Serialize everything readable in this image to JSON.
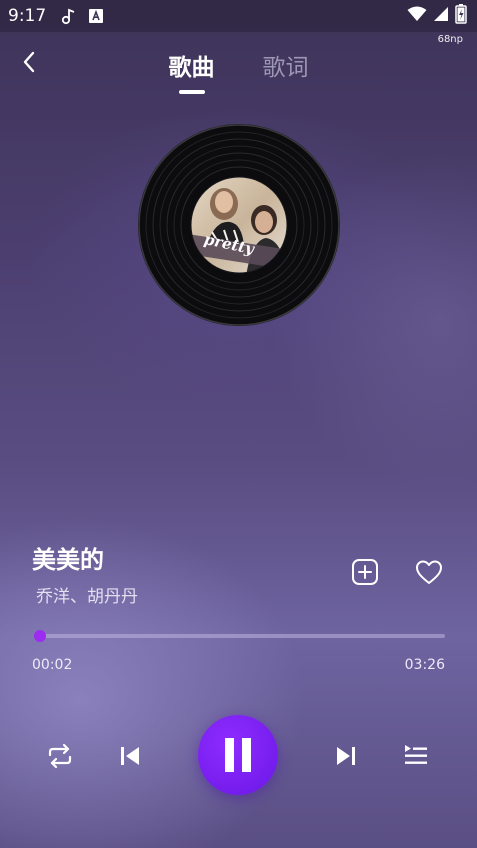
{
  "status_bar": {
    "time": "9:17",
    "icons": [
      "music-note-icon",
      "a-box-icon",
      "wifi-icon",
      "signal-icon",
      "battery-icon"
    ]
  },
  "np_badge": "68np",
  "tabs": [
    {
      "label": "歌曲",
      "active": true
    },
    {
      "label": "歌词",
      "active": false
    }
  ],
  "song": {
    "title": "美美的",
    "artist": "乔洋、胡丹丹",
    "cover_text": "pretty"
  },
  "progress": {
    "current": "00:02",
    "total": "03:26",
    "fraction": 0.0097
  },
  "colors": {
    "accent": "#8a2be2",
    "play_button": "#7b20f5"
  }
}
